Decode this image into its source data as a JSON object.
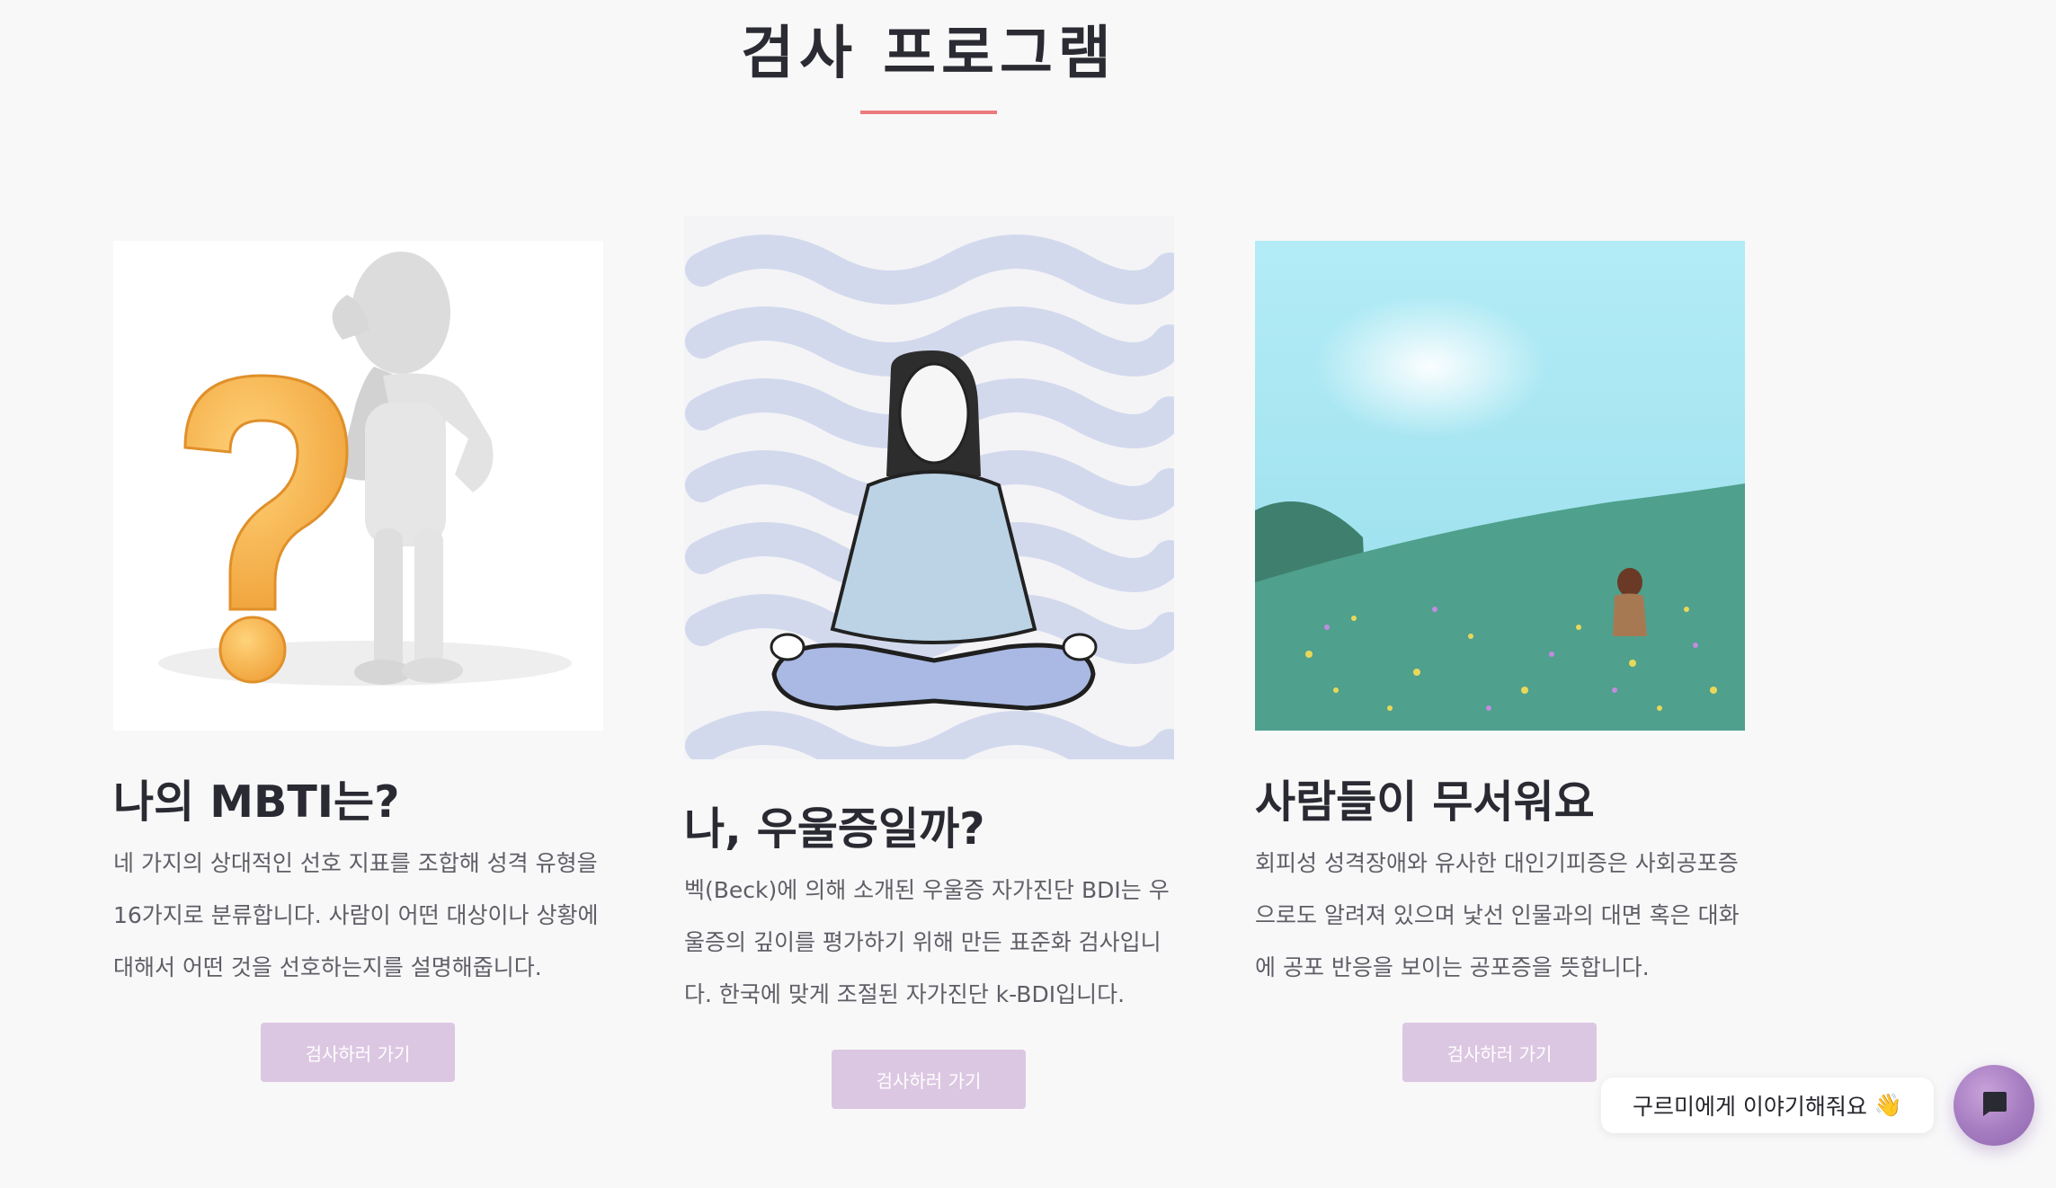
{
  "section": {
    "title": "검사 프로그램",
    "accent_color": "#ec7a7d"
  },
  "cards": [
    {
      "image_icon": "question-mark-thinking-figure-image",
      "title": "나의 MBTI는?",
      "description": "네 가지의 상대적인 선호 지표를 조합해 성격 유형을 16가지로 분류합니다. 사람이 어떤 대상이나 상황에 대해서 어떤 것을 선호하는지를 설명해줍니다.",
      "button_label": "검사하러 가기"
    },
    {
      "image_icon": "meditating-woman-image",
      "title": "나, 우울증일까?",
      "description": "벡(Beck)에 의해 소개된 우울증 자가진단 BDI는 우울증의 깊이를 평가하기 위해 만든 표준화 검사입니다. 한국에 맞게 조절된 자가진단 k-BDI입니다.",
      "button_label": "검사하러 가기"
    },
    {
      "image_icon": "person-in-flower-field-image",
      "title": "사람들이 무서워요",
      "description": "회피성 성격장애와 유사한 대인기피증은 사회공포증으로도 알려져 있으며 낯선 인물과의 대면 혹은 대화에 공포 반응을 보이는 공포증을 뜻합니다.",
      "button_label": "검사하러 가기"
    }
  ],
  "button_color": "#dcc7e2",
  "chat": {
    "prompt_text": "구르미에게 이야기해줘요",
    "prompt_emoji": "👋",
    "launcher_icon": "chat-bubble-icon",
    "launcher_color": "#a57bc0"
  }
}
